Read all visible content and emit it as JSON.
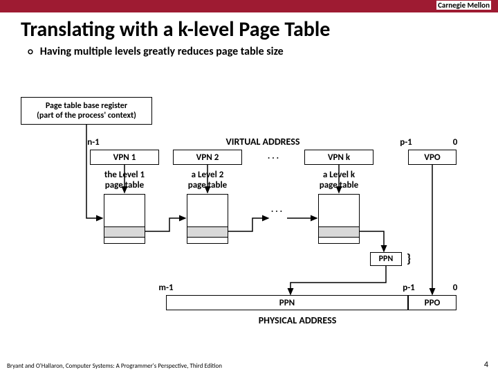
{
  "header": {
    "institution": "Carnegie Mellon"
  },
  "slide": {
    "title": "Translating with a k-level Page Table",
    "bullet1": "Having multiple levels greatly reduces page table size"
  },
  "diagram": {
    "ptbr_label": "Page table base register\n(part of the process' context)",
    "va_title": "VIRTUAL ADDRESS",
    "pa_title": "PHYSICAL ADDRESS",
    "bits": {
      "n1": "n-1",
      "p1": "p-1",
      "zero": "0",
      "m1": "m-1"
    },
    "va_fields": {
      "vpn1": "VPN 1",
      "vpn2": "VPN 2",
      "dots": ". . .",
      "vpnk": "VPN k",
      "vpo": "VPO"
    },
    "tables": {
      "lvl1": "the Level 1\npage table",
      "lvl2": "a Level 2\npage table",
      "dots": ". . .",
      "lvlk": "a Level k\npage table"
    },
    "ppn_small": "PPN",
    "brace": "}",
    "pa_fields": {
      "ppn": "PPN",
      "ppo": "PPO"
    }
  },
  "footer": {
    "text": "Bryant and O'Hallaron, Computer Systems: A Programmer's Perspective, Third Edition",
    "page": "4"
  }
}
